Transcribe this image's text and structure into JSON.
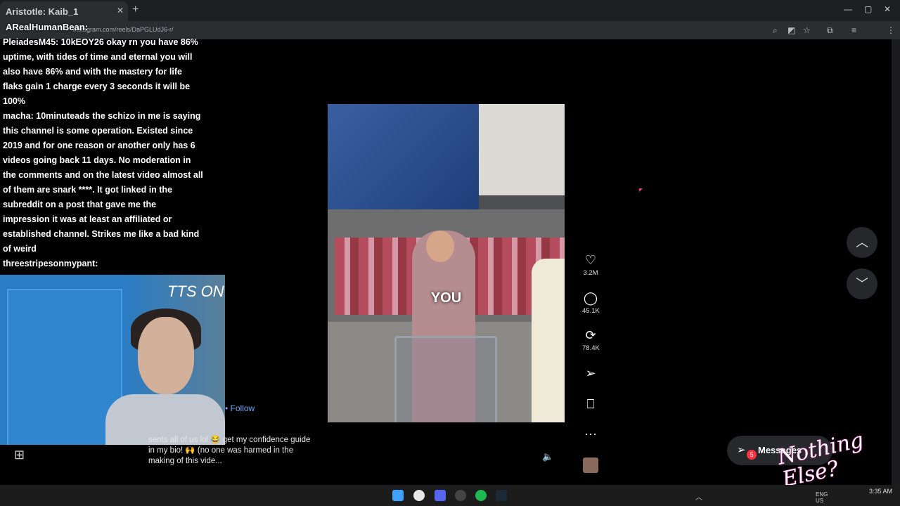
{
  "browser": {
    "tab_title": "Aristotle: Kaib_1",
    "url": "instagram.com/reels/DaPGLUdJ6-r/"
  },
  "chat": {
    "top_user": "ARealHumanBean:",
    "messages": [
      "PleiadesM45: 10kEOY26 okay rn you have 86% uptime, with tides of time and eternal you will also have 86% and with the mastery for life flaks gain 1 charge every 3 seconds it will be 100%",
      "macha: 10minuteads the schizo in me is saying this channel is some operation. Existed since 2019 and for one reason or another only has 6 videos going back 11 days. No moderation in the comments and on the latest video almost all of them are snark ****. It got linked in the subreddit on a post that gave me the impression it was at least an affiliated or established channel. Strikes me like a bad kind of weird",
      "threestripesonmypant:"
    ]
  },
  "reel": {
    "caption_overlay": "YOU",
    "post_caption": "sents all of us lol 😂 get my confidence guide in my bio! 🙌 (no one was harmed in the making of this vide...",
    "follow_label": "• Follow",
    "actions": {
      "likes": "3.2M",
      "comments": "45.1K",
      "reposts": "78.4K"
    }
  },
  "overlay": {
    "tts_text": "TTS ON",
    "logo_text": "Nothing Else?"
  },
  "messages_button": {
    "label": "Messages",
    "badge": "5"
  },
  "taskbar": {
    "lang": "ENG US",
    "time": "3:35 AM"
  },
  "colors": {
    "accent_link": "#6fa8ff",
    "badge_red": "#ff3040"
  }
}
